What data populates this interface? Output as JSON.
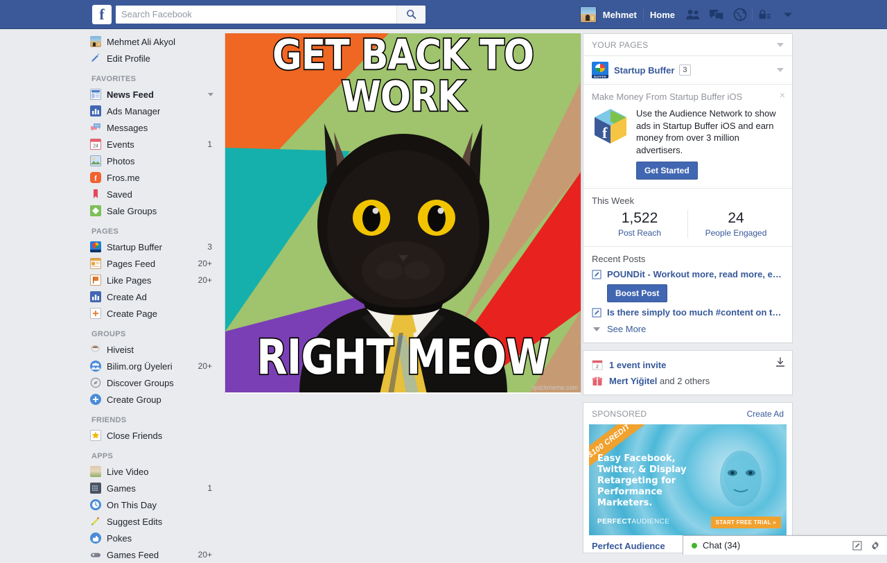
{
  "topbar": {
    "logo": "f",
    "search_placeholder": "Search Facebook",
    "search_value": "",
    "search_icon": "search-icon",
    "profile_name": "Mehmet",
    "home_label": "Home",
    "icons": [
      "friend-requests-icon",
      "messages-icon",
      "notifications-globe-icon",
      "privacy-lock-icon",
      "account-chevron-down-icon"
    ]
  },
  "sidebar": {
    "profile": {
      "label": "Mehmet Ali Akyol"
    },
    "edit_profile": {
      "label": "Edit Profile"
    },
    "sections": [
      {
        "title": "FAVORITES",
        "items": [
          {
            "label": "News Feed",
            "count": "",
            "bold": true,
            "caret": true
          },
          {
            "label": "Ads Manager",
            "count": ""
          },
          {
            "label": "Messages",
            "count": ""
          },
          {
            "label": "Events",
            "count": "1"
          },
          {
            "label": "Photos",
            "count": ""
          },
          {
            "label": "Fros.me",
            "count": ""
          },
          {
            "label": "Saved",
            "count": ""
          },
          {
            "label": "Sale Groups",
            "count": ""
          }
        ]
      },
      {
        "title": "PAGES",
        "items": [
          {
            "label": "Startup Buffer",
            "count": "3"
          },
          {
            "label": "Pages Feed",
            "count": "20+"
          },
          {
            "label": "Like Pages",
            "count": "20+"
          },
          {
            "label": "Create Ad",
            "count": ""
          },
          {
            "label": "Create Page",
            "count": ""
          }
        ]
      },
      {
        "title": "GROUPS",
        "items": [
          {
            "label": "Hiveist",
            "count": ""
          },
          {
            "label": "Bilim.org Üyeleri",
            "count": "20+"
          },
          {
            "label": "Discover Groups",
            "count": ""
          },
          {
            "label": "Create Group",
            "count": ""
          }
        ]
      },
      {
        "title": "FRIENDS",
        "items": [
          {
            "label": "Close Friends",
            "count": ""
          }
        ]
      },
      {
        "title": "APPS",
        "items": [
          {
            "label": "Live Video",
            "count": ""
          },
          {
            "label": "Games",
            "count": "1"
          },
          {
            "label": "On This Day",
            "count": ""
          },
          {
            "label": "Suggest Edits",
            "count": ""
          },
          {
            "label": "Pokes",
            "count": ""
          },
          {
            "label": "Games Feed",
            "count": "20+"
          }
        ]
      }
    ]
  },
  "main": {
    "meme": {
      "top_text": "GET BACK TO WORK",
      "bottom_text": "RIGHT MEOW",
      "watermark": "quickmeme.com"
    }
  },
  "right": {
    "your_pages": {
      "header": "YOUR PAGES",
      "page_name": "Startup Buffer",
      "page_badge": "3"
    },
    "promo": {
      "title": "Make Money From Startup Buffer iOS",
      "body": "Use the Audience Network to show ads in Startup Buffer iOS and earn money from over 3 million advertisers.",
      "cta": "Get Started",
      "close": "×"
    },
    "this_week": {
      "title": "This Week",
      "stats": [
        {
          "value": "1,522",
          "label": "Post Reach"
        },
        {
          "value": "24",
          "label": "People Engaged"
        }
      ]
    },
    "recent_posts": {
      "title": "Recent Posts",
      "posts": [
        {
          "text": "POUNDit - Workout more, read more, explore..",
          "boost": "Boost Post"
        },
        {
          "text": "Is there simply too much #content on the Int..."
        }
      ],
      "see_more": "See More"
    },
    "events": {
      "invite": "1 event invite",
      "birthday_name": "Mert Yiğitel",
      "birthday_rest": " and 2 others"
    },
    "sponsored": {
      "label": "SPONSORED",
      "create_ad": "Create Ad",
      "ad": {
        "ribbon": "$100 CREDIT",
        "copy": "Easy Facebook, Twitter, & Display Retargeting for Performance Marketers.",
        "brand_bold": "PERFECT",
        "brand_light": "AUDIENCE",
        "cta": "START FREE TRIAL »",
        "title": "Perfect Audience"
      }
    }
  },
  "chat": {
    "label": "Chat (34)",
    "status_color": "#42b72a",
    "compose_icon": "compose-icon",
    "settings_icon": "gear-icon"
  }
}
